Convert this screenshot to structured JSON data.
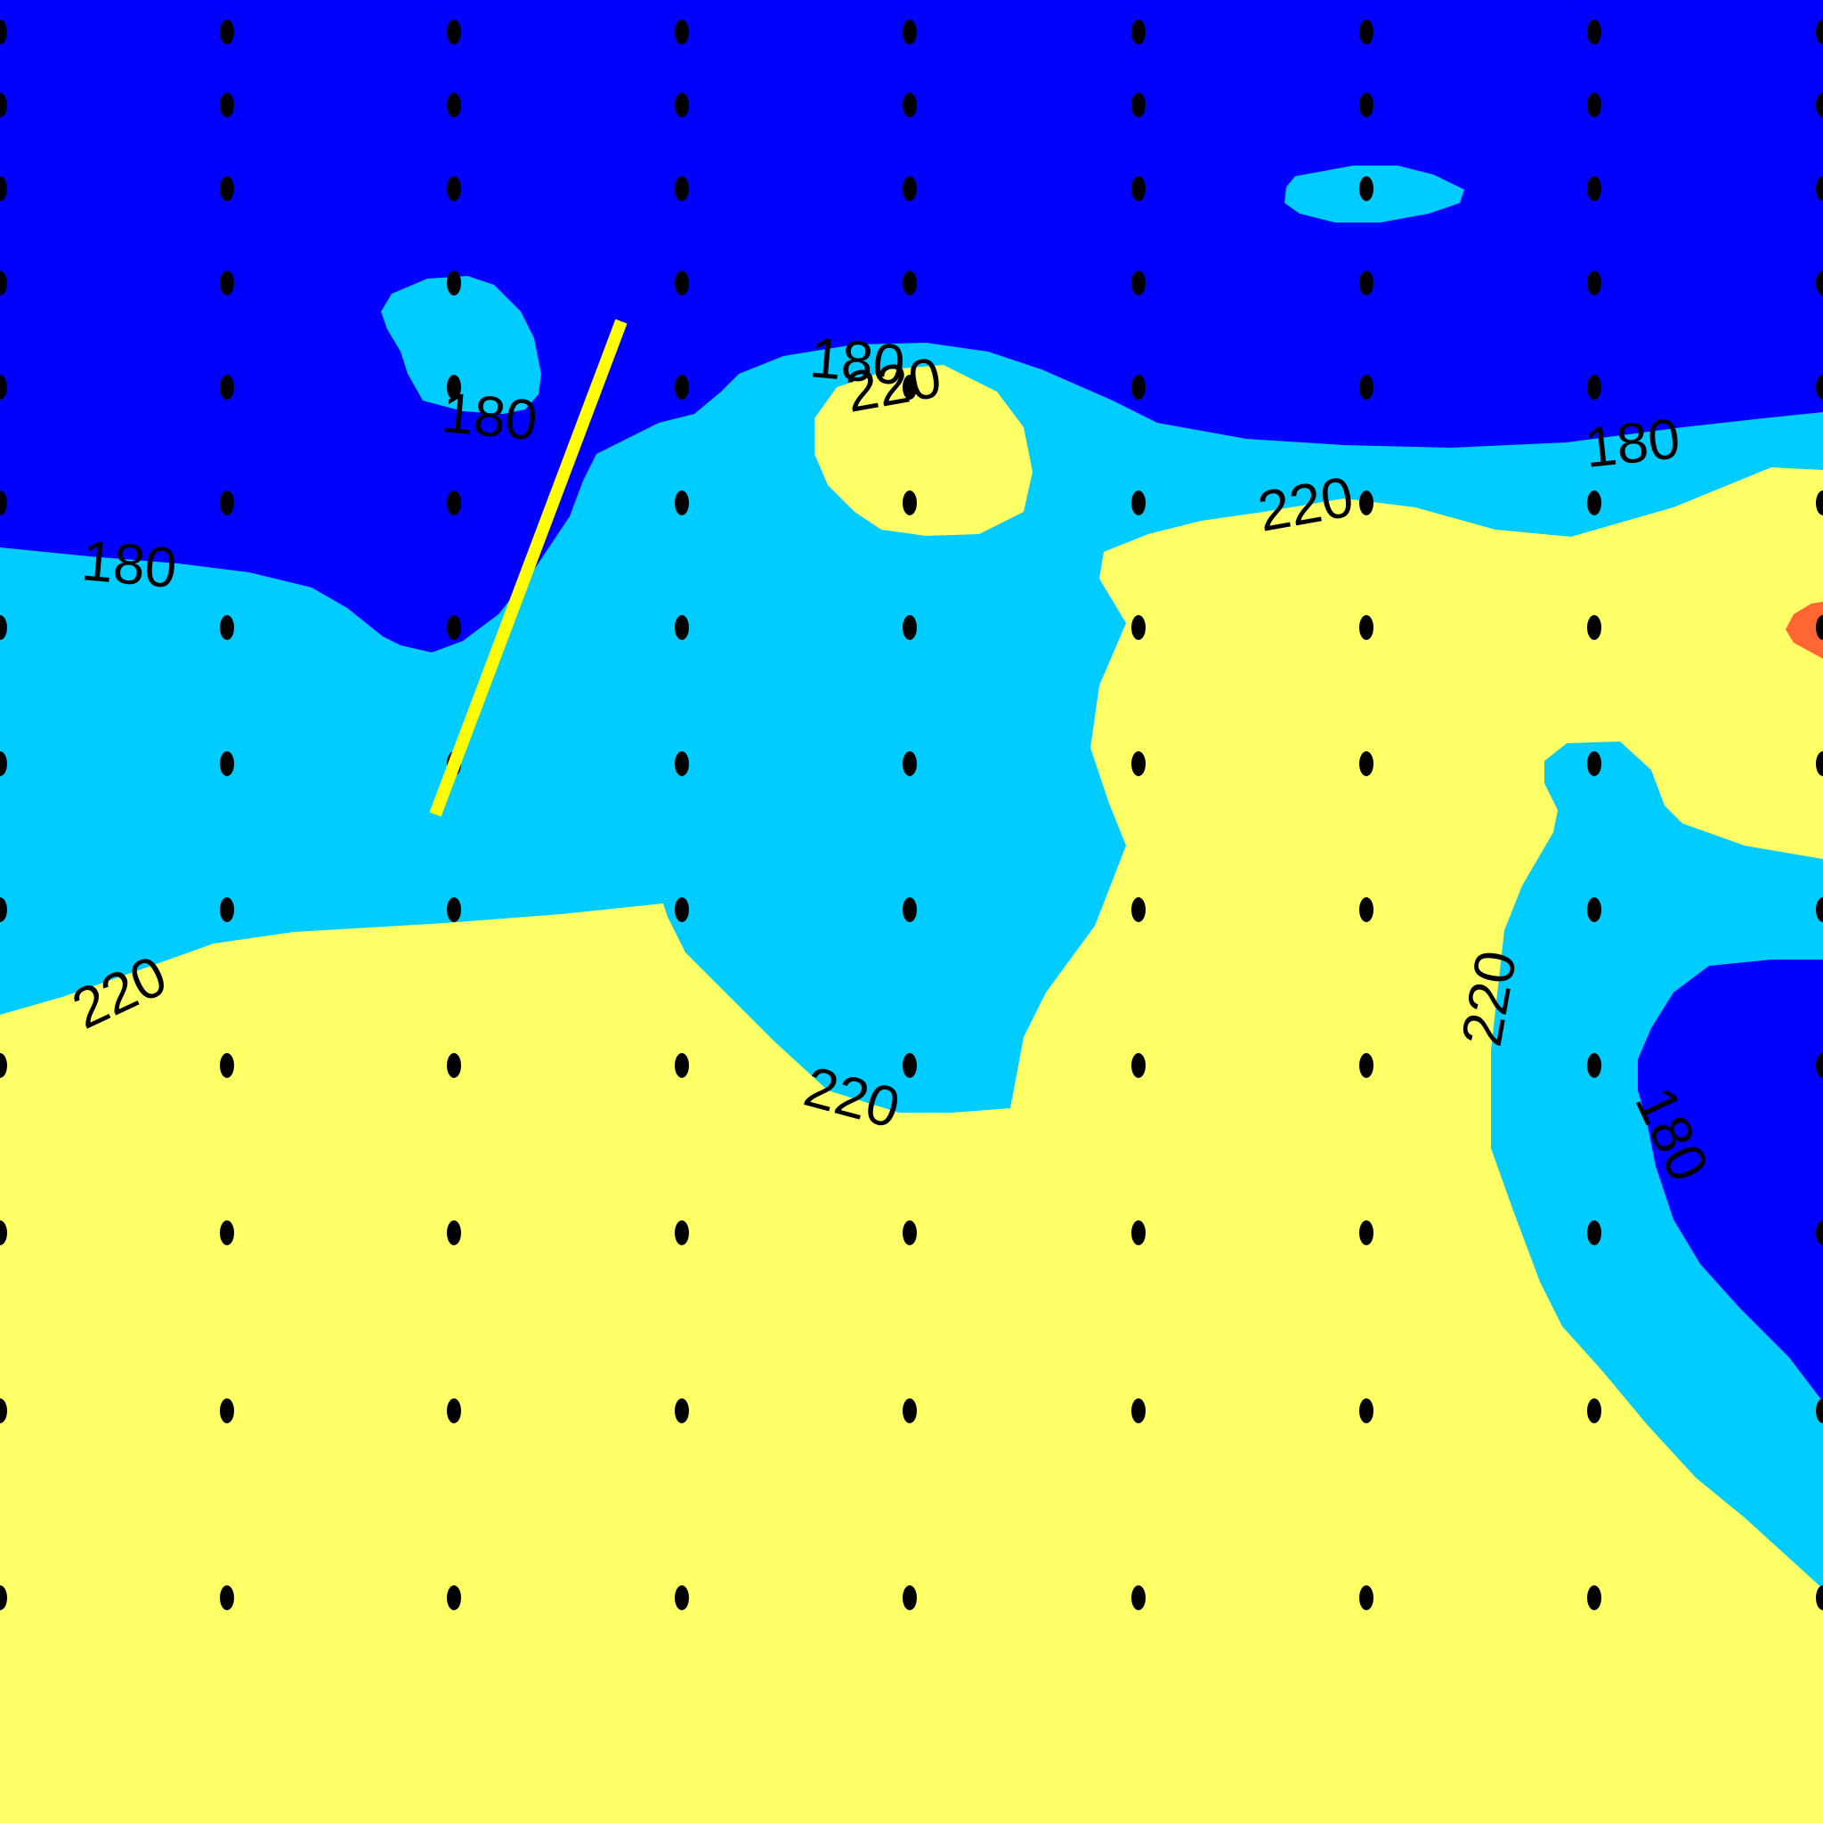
{
  "colors": {
    "low_band": "#0000ff",
    "mid_band": "#00ccff",
    "high_band": "#ffff66",
    "peak_band": "#ff6633",
    "transect_line": "#ffff00",
    "station_dot": "#000000"
  },
  "contour_levels": [
    "180",
    "220"
  ],
  "labels": {
    "l1": "180",
    "l2": "180",
    "l3": "180",
    "l4": "180",
    "l5": "180",
    "l6": "220",
    "l7": "220",
    "l8": "220",
    "l9": "220",
    "l10": "220",
    "l11": "220"
  }
}
